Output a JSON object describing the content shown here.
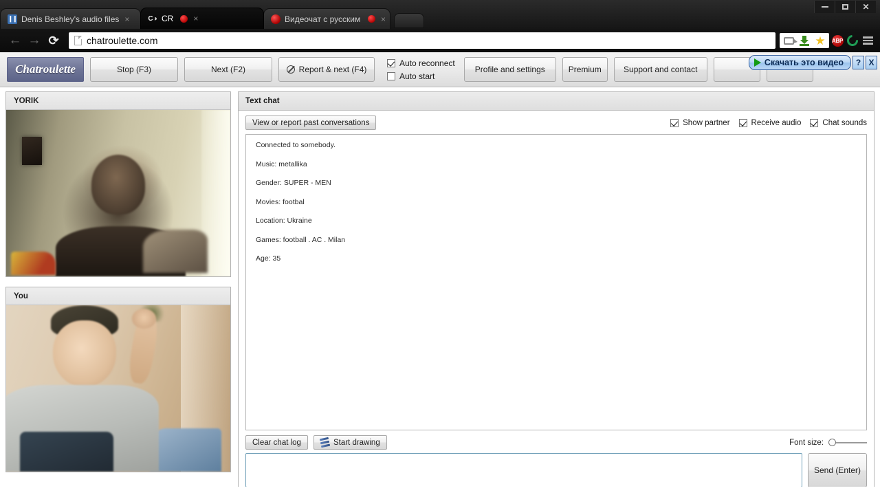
{
  "browser": {
    "window_controls": {
      "minimize": "minimize-icon",
      "maximize": "maximize-icon",
      "close": "close-icon"
    },
    "tabs": [
      {
        "title": "Denis Beshley's audio files",
        "favicon": "pause-icon",
        "active": false,
        "recording": false,
        "close": "×"
      },
      {
        "title": "CR",
        "favicon": "cr-icon",
        "active": true,
        "recording": true,
        "close": "×"
      },
      {
        "title": "Видеочат с русскими",
        "favicon": "red-ball-icon",
        "active": false,
        "recording": true,
        "close": "×"
      }
    ],
    "new_tab_label": "",
    "nav": {
      "back": "←",
      "forward": "→",
      "reload": "⟳"
    },
    "url": "chatroulette.com",
    "extensions": [
      "video-camera-icon",
      "download-icon",
      "star-icon",
      "adblock-plus-icon",
      "green-circle-icon",
      "hamburger-menu-icon"
    ],
    "abp_label": "ABP"
  },
  "download_overlay": {
    "label": "Скачать это видео",
    "help_label": "?",
    "close_label": "X",
    "accent": "#3a63a0"
  },
  "toolbar": {
    "logo": "Chatroulette",
    "logo_bg": "#6e7496",
    "stop_label": "Stop (F3)",
    "next_label": "Next (F2)",
    "report_label": "Report & next (F4)",
    "auto_reconnect_label": "Auto reconnect",
    "auto_reconnect_checked": true,
    "auto_start_label": "Auto start",
    "auto_start_checked": false,
    "profile_label": "Profile and settings",
    "premium_label": "Premium",
    "support_label": "Support and contact",
    "hidden_button_a": "",
    "hidden_button_b": ""
  },
  "video": {
    "partner": {
      "title": "YORIK"
    },
    "self": {
      "title": "You"
    }
  },
  "chat": {
    "panel_title": "Text chat",
    "past_conversations_label": "View or report past conversations",
    "options": [
      {
        "label": "Show partner",
        "checked": true
      },
      {
        "label": "Receive audio",
        "checked": true
      },
      {
        "label": "Chat sounds",
        "checked": true
      }
    ],
    "messages": [
      "Connected to somebody.",
      "Music: metallika",
      "Gender: SUPER - MEN",
      "Movies: footbal",
      "Location: Ukraine",
      "Games: football . AC . Milan",
      "Age: 35"
    ],
    "clear_log_label": "Clear chat log",
    "start_drawing_label": "Start drawing",
    "font_size_label": "Font size:",
    "font_size_value": 0,
    "input_value": "",
    "input_placeholder": "",
    "send_label": "Send (Enter)"
  }
}
